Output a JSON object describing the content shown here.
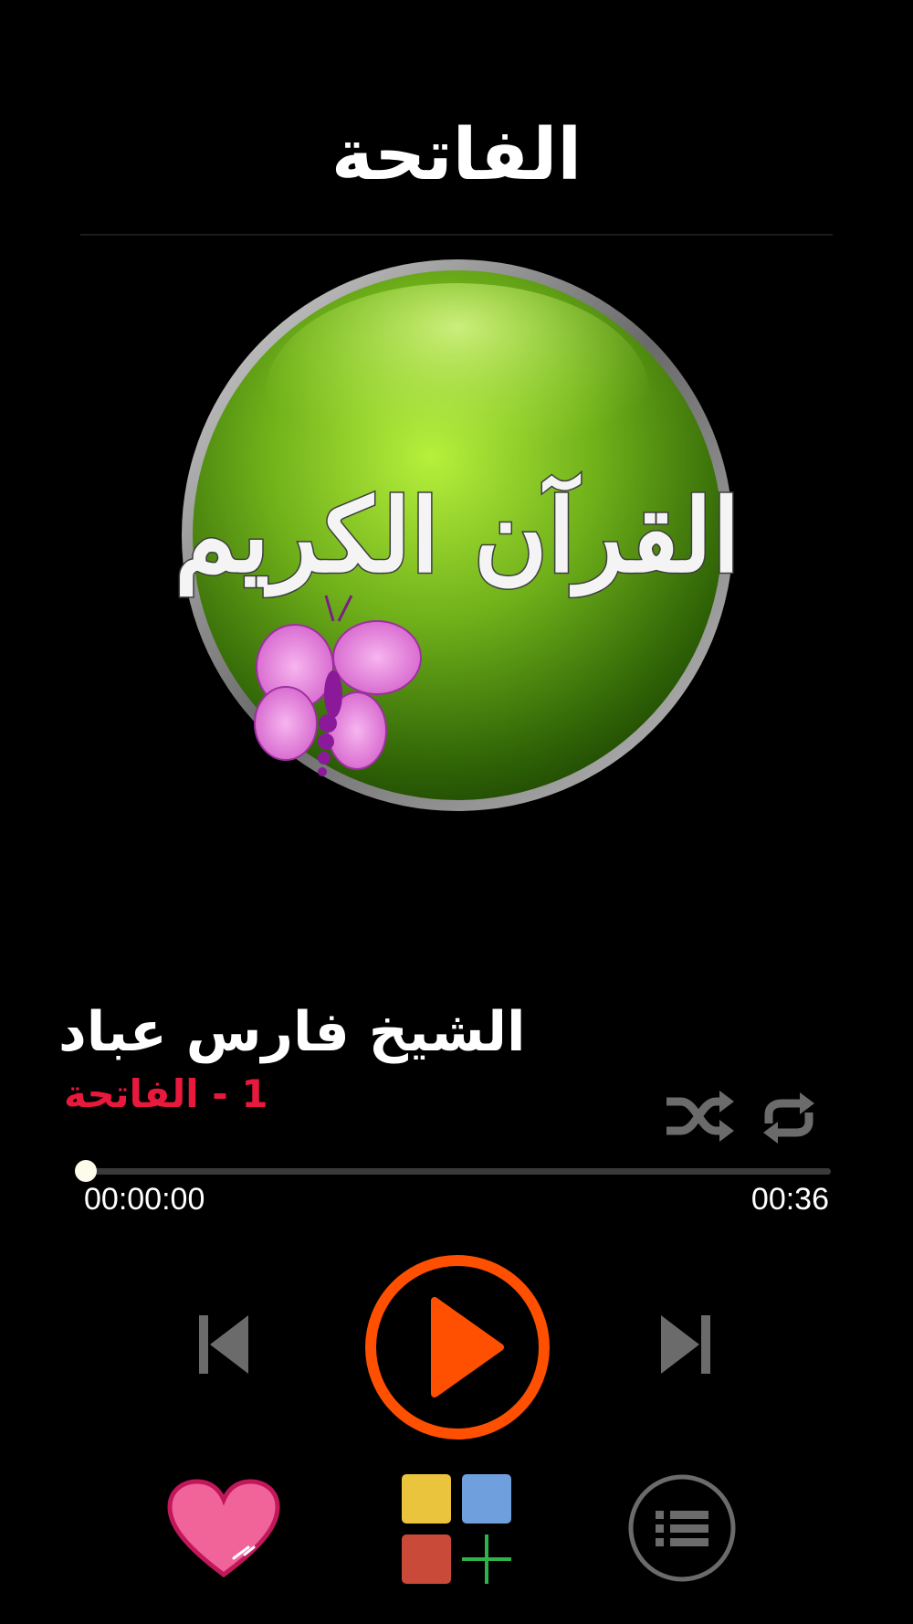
{
  "header": {
    "title": "الفاتحة"
  },
  "artwork": {
    "calligraphy_text": "القرآن الكريم",
    "accent_color": "#6fb01a"
  },
  "now_playing": {
    "reciter": "الشيخ فارس عباد",
    "track": "1 - الفاتحة"
  },
  "controls": {
    "shuffle_icon": "shuffle-icon",
    "repeat_icon": "repeat-icon",
    "previous_icon": "skip-previous-icon",
    "play_icon": "play-icon",
    "next_icon": "skip-next-icon"
  },
  "progress": {
    "elapsed": "00:00:00",
    "total": "00:36",
    "position": 0
  },
  "bottom_bar": {
    "favorite_icon": "heart-icon",
    "themes_icon": "color-palette-add-icon",
    "playlist_icon": "list-icon"
  },
  "colors": {
    "background": "#000000",
    "track_title": "#e8193c",
    "play_button": "#fe5000",
    "heart": "#f0649a",
    "inactive_icon": "#6b6b6b"
  }
}
